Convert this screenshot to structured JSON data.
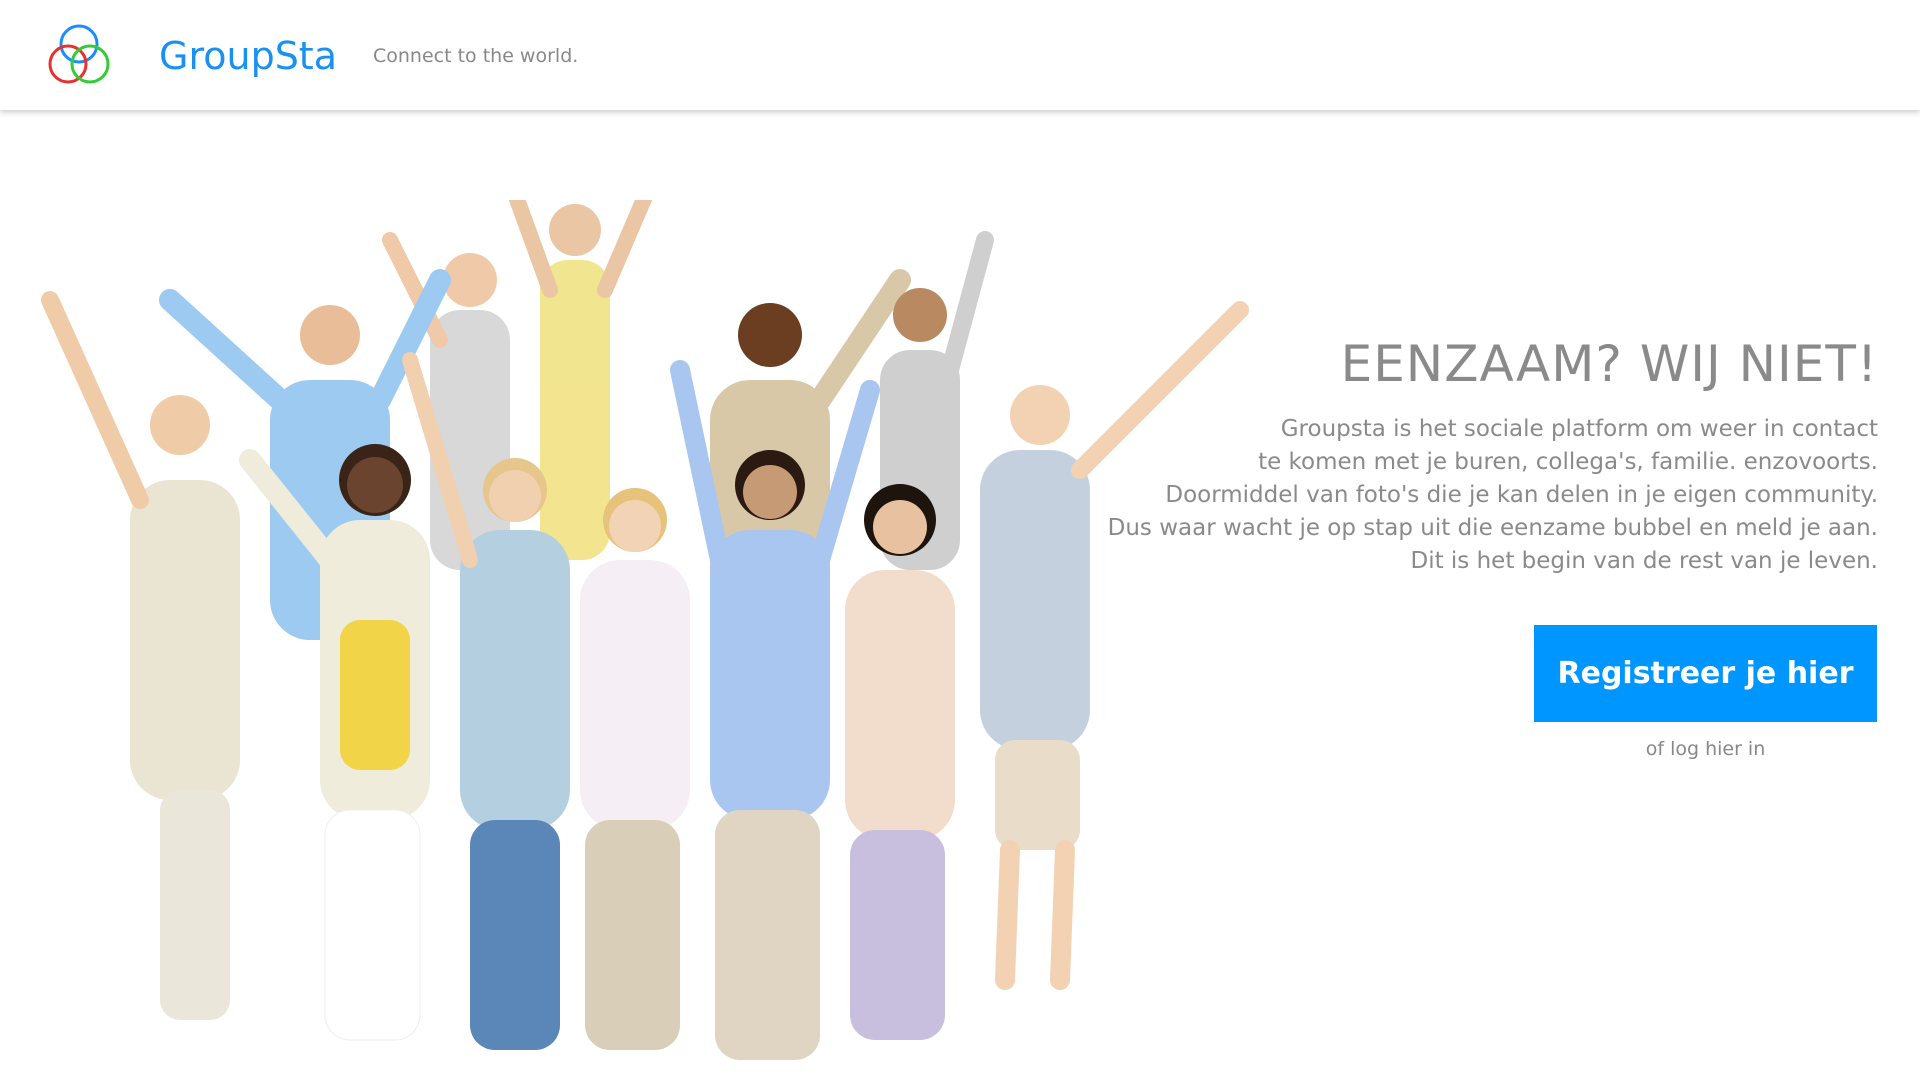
{
  "header": {
    "brand_name": "GroupSta",
    "tagline": "Connect to the world.",
    "logo_icon": "three-rings-logo-icon",
    "brand_color": "#1a90f0"
  },
  "hero": {
    "image": "group-of-people-cheering",
    "headline": "EENZAAM? WIJ NIET!",
    "intro_lines": [
      "Groupsta is het sociale platform om weer in contact",
      "te komen met  je buren, collega's, familie. enzovoorts.",
      "Doormiddel van foto's die je kan delen in je eigen community.",
      "Dus waar wacht je op stap uit die eenzame bubbel en meld je aan.",
      "Dit is het begin van de rest van je leven."
    ],
    "register_label": "Registreer je hier",
    "login_label": "of log hier in",
    "accent_color": "#0096ff",
    "text_color": "#8a8a8a"
  }
}
